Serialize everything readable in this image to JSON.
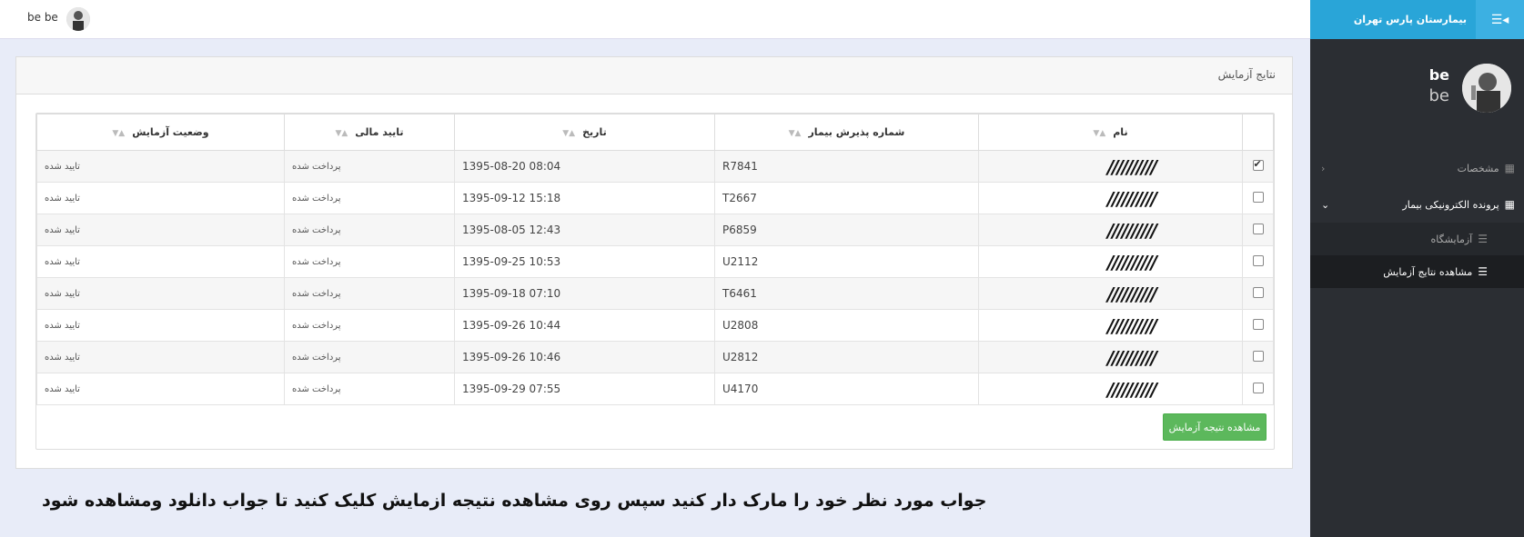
{
  "sidebar": {
    "brand_title": "بیمارستان پارس تهران",
    "toggle_icon": "menu-icon",
    "profile_name": "be",
    "profile_sub": "be",
    "items": [
      {
        "label": "مشخصات",
        "icon": "grid-icon"
      },
      {
        "label": "پرونده الکترونیکی بیمار",
        "icon": "grid-icon"
      }
    ],
    "subitems": [
      {
        "label": "آزمایشگاه",
        "icon": "list-icon"
      },
      {
        "label": "مشاهده نتایج آزمایش",
        "icon": "list-icon"
      }
    ]
  },
  "topbar": {
    "user": "be be"
  },
  "panel": {
    "title": "نتایج آزمایش",
    "columns": [
      "نام",
      "شماره پذیرش بیمار",
      "تاریخ",
      "تایید مالی",
      "وضعیت آزمایش"
    ],
    "rows": [
      {
        "checked": true,
        "id": "R7841",
        "date": "1395-08-20 08:04",
        "payment": "پرداخت شده",
        "status": "تایید شده"
      },
      {
        "checked": false,
        "id": "T2667",
        "date": "1395-09-12 15:18",
        "payment": "پرداخت شده",
        "status": "تایید شده"
      },
      {
        "checked": false,
        "id": "P6859",
        "date": "1395-08-05 12:43",
        "payment": "پرداخت شده",
        "status": "تایید شده"
      },
      {
        "checked": false,
        "id": "U2112",
        "date": "1395-09-25 10:53",
        "payment": "پرداخت شده",
        "status": "تایید شده"
      },
      {
        "checked": false,
        "id": "T6461",
        "date": "1395-09-18 07:10",
        "payment": "پرداخت شده",
        "status": "تایید شده"
      },
      {
        "checked": false,
        "id": "U2808",
        "date": "1395-09-26 10:44",
        "payment": "پرداخت شده",
        "status": "تایید شده"
      },
      {
        "checked": false,
        "id": "U2812",
        "date": "1395-09-26 10:46",
        "payment": "پرداخت شده",
        "status": "تایید شده"
      },
      {
        "checked": false,
        "id": "U4170",
        "date": "1395-09-29 07:55",
        "payment": "پرداخت شده",
        "status": "تایید شده"
      }
    ],
    "button_label": "مشاهده نتیجه آزمایش"
  },
  "instruction": "جواب مورد نظر خود را مارک دار کنید سپس روی مشاهده نتیجه ازمایش کلیک کنید تا جواب دانلود ومشاهده شود"
}
